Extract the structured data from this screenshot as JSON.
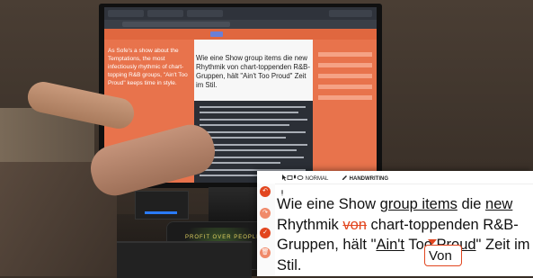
{
  "background_screen": {
    "left_text": "As Sofe's a show about the Temptations, the most infectiously rhythmic of chart-topping R&B groups, \"Ain't Too Proud\" keeps time in style.",
    "mid_text": "Wie eine Show group items die new Rhythmik von chart-toppenden R&B-Gruppen, hält \"Ain't Too Proud\" Zeit im Stil.",
    "desk_pad_text": "PROFIT OVER PEOPLE"
  },
  "overlay": {
    "toolbar": {
      "mode_label": "NORMAL",
      "handwriting_label": "HANDWRITING"
    },
    "translation": {
      "line1_a": "Wie eine Show ",
      "line1_u1": "group items",
      "line1_b": " die ",
      "line1_u2": "new",
      "line2_a": "Rhythmik ",
      "line2_del": "von",
      "line2_b": " chart-toppenden R&B-",
      "line3_a": "Gruppen, hält \"",
      "line3_u1": "Ain't",
      "line3_b": " Too ",
      "line3_u2": "Proud",
      "line3_c": "\" Zeit im",
      "line4": "Stil."
    },
    "correction_popup": "Von"
  },
  "colors": {
    "accent": "#e0673f",
    "delete": "#e2461f",
    "confirm": "#e2461f"
  },
  "icons": [
    "cursor-icon",
    "keyboard-icon",
    "microphone-icon",
    "eye-icon",
    "pencil-icon",
    "undo-icon",
    "redo-icon",
    "check-icon",
    "delete-icon"
  ]
}
